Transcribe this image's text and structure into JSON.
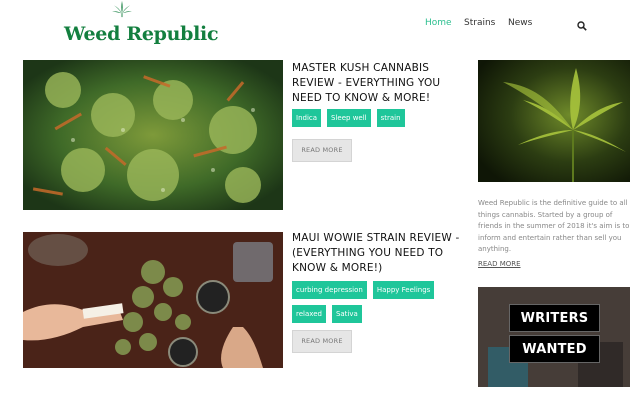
{
  "header": {
    "logo_text": "Weed Republic",
    "logo_icon": "cannabis-leaf-icon",
    "nav": [
      {
        "label": "Home",
        "active": true
      },
      {
        "label": "Strains",
        "active": false
      },
      {
        "label": "News",
        "active": false
      }
    ],
    "search_icon": "search-icon"
  },
  "posts": [
    {
      "title": "MASTER KUSH CANNABIS REVIEW - EVERYTHING YOU NEED TO KNOW & MORE!",
      "tags": [
        "Indica",
        "Sleep well",
        "strain"
      ],
      "read_more": "READ MORE"
    },
    {
      "title": "MAUI WOWIE STRAIN REVIEW - (EVERYTHING YOU NEED TO KNOW & MORE!)",
      "tags": [
        "curbing depression",
        "Happy Feelings",
        "relaxed",
        "Sativa"
      ],
      "read_more": "READ MORE"
    }
  ],
  "sidebar": {
    "about": "Weed Republic is the definitive guide to all things cannabis. Started by a group of friends in the summer of 2018 it's aim is to inform and entertain rather than sell you anything.",
    "read_more": "READ MORE",
    "ad_line1": "WRITERS",
    "ad_line2": "WANTED"
  },
  "colors": {
    "brand_green": "#137f3f",
    "accent": "#1fc69a",
    "nav_active": "#2cbf8f"
  }
}
